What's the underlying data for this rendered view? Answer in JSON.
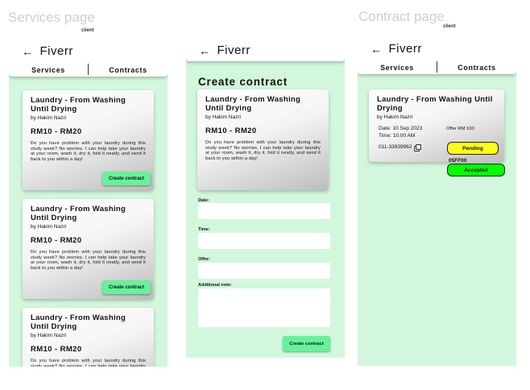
{
  "labels": {
    "services_page": "Services page",
    "contract_page": "Contract page",
    "client_tag": "client"
  },
  "app": {
    "brand": "Fiverr",
    "back_icon": "arrow-left-icon"
  },
  "tabs": [
    "Services",
    "Contracts"
  ],
  "service": {
    "title": "Laundry - From Washing Until Drying",
    "author": "by Hakim Nazri",
    "price": "RM10 - RM20",
    "description": "Do you have problem with your laundry during this study week? No worries. I can help take your laundry at your room, wash it, dry it, fold it neatly, and send it back to you within a day!"
  },
  "buttons": {
    "create_contract": "Create contract"
  },
  "create_form": {
    "heading": "Create contract",
    "date_label": "Date:",
    "time_label": "Time:",
    "offer_label": "Offer:",
    "note_label": "Additional note:",
    "submit": "Create contract"
  },
  "contract": {
    "date": "Date: 10 Sep 2023",
    "time": "Time: 10.00 AM",
    "offer": "Offer RM 100",
    "phone": "011-33939962",
    "copy_icon": "copy-icon",
    "status_pending": "Pending",
    "status_code": "05FF00",
    "status_accepted": "Accepted"
  },
  "colors": {
    "frame_bg": "#d3f7dc",
    "button_green": "#66f29a",
    "pending_yellow": "#ffff1a",
    "accepted_green": "#05ff00"
  }
}
